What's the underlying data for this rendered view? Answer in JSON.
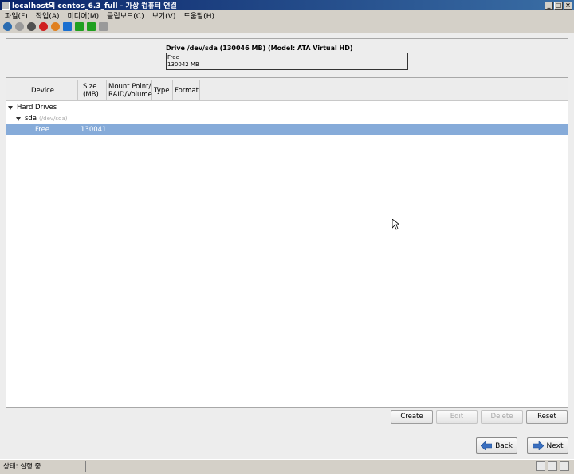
{
  "window": {
    "title": "localhost의 centos_6.3_full - 가상 컴퓨터 연결",
    "minimize": "_",
    "maximize": "□",
    "close": "×"
  },
  "menu": [
    "파일(F)",
    "작업(A)",
    "미디어(M)",
    "클립보드(C)",
    "보기(V)",
    "도움말(H)"
  ],
  "toolbar": {
    "icons": [
      "ctrl-alt-del-icon",
      "start-icon",
      "turn-off-icon",
      "shutdown-icon",
      "save-icon",
      "pause-icon",
      "resume-icon",
      "snapshot-icon",
      "revert-icon"
    ],
    "colors": [
      "#2b6cb0",
      "#9a9a9a",
      "#505050",
      "#d02020",
      "#e08020",
      "#1a6fd0",
      "#20a020",
      "#20a020",
      "#9a9a9a"
    ]
  },
  "drive": {
    "title": "Drive /dev/sda (130046 MB) (Model: ATA Virtual HD)",
    "bar_label": "Free",
    "bar_size": "130042 MB"
  },
  "table": {
    "columns": [
      "Device",
      "Size (MB)",
      "Mount Point/ RAID/Volume",
      "Type",
      "Format"
    ],
    "group": "Hard Drives",
    "disk_name": "sda",
    "disk_path": "(/dev/sda)",
    "free_row": {
      "device": "Free",
      "size": "130041"
    }
  },
  "buttons": {
    "create": "Create",
    "edit": "Edit",
    "delete": "Delete",
    "reset": "Reset",
    "back": "Back",
    "next": "Next"
  },
  "status": {
    "text": "상태: 실행 중"
  },
  "colors": {
    "selection": "#86abd9",
    "titlebar": "#0a246a"
  }
}
